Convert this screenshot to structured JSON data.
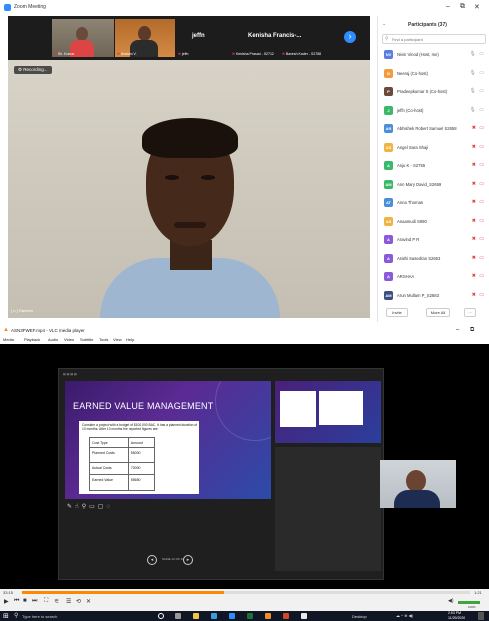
{
  "zoom": {
    "title": "Zoom Meeting",
    "window_controls": [
      "–",
      "⧉",
      "✕"
    ],
    "thumbnails": [
      {
        "label": "Sh. Kumar",
        "muted": true
      },
      {
        "label": "Ibrahim V.",
        "muted": true
      },
      {
        "label": "jeffn",
        "muted": true
      },
      {
        "label": "Kenisha Prasad - S2712",
        "muted": true
      },
      {
        "label": "Bavesh Kader - S2788",
        "muted": true
      }
    ],
    "speaker_name_a": "jeffn",
    "speaker_name_b": "Kenisha Francis-...",
    "next_arrow": "›",
    "view_badge": "Recording...",
    "self_label": "[ n ] Ganesh",
    "participants": {
      "title": "Participants (37)",
      "search_placeholder": "Find a participant",
      "list": [
        {
          "initials": "NV",
          "name": "Nivin Vinod (Host, me)",
          "color": "#5a7de0",
          "icons": "🎙 ▭",
          "red": false
        },
        {
          "initials": "N",
          "name": "Neeraj (Co-host)",
          "color": "#f39c3d",
          "icons": "🎙 ▭",
          "red": false
        },
        {
          "initials": "P",
          "name": "Pradeepkumar S (Co-host)",
          "color": "#6b4a3a",
          "icons": "🎙 ▭",
          "red": false
        },
        {
          "initials": "J",
          "name": "jeffn (Co-host)",
          "color": "#3bb86a",
          "icons": "🎙 ▭",
          "red": false
        },
        {
          "initials": "AR",
          "name": "Abhishek Robert Samuel S2658",
          "color": "#4a8fd8",
          "icons": "✖ ▭",
          "red": true
        },
        {
          "initials": "AS",
          "name": "Angel Sara Shaji",
          "color": "#f0b442",
          "icons": "✖ ▭",
          "red": true
        },
        {
          "initials": "A",
          "name": "Anju K - S2755",
          "color": "#3bb86a",
          "icons": "✖ ▭",
          "red": true
        },
        {
          "initials": "AM",
          "name": "Ann Mary David_S2659",
          "color": "#3bb86a",
          "icons": "✖ ▭",
          "red": true
        },
        {
          "initials": "AT",
          "name": "Anna Thomas",
          "color": "#4a8fd8",
          "icons": "✖ ▭",
          "red": true
        },
        {
          "initials": "AS",
          "name": "Anaamudi S990",
          "color": "#f0b442",
          "icons": "✖ ▭",
          "red": true
        },
        {
          "initials": "A",
          "name": "Aravind P R",
          "color": "#8a5ad8",
          "icons": "✖ ▭",
          "red": true
        },
        {
          "initials": "A",
          "name": "Arathi Sasedran S2663",
          "color": "#8a5ad8",
          "icons": "✖ ▭",
          "red": true
        },
        {
          "initials": "A",
          "name": "ARSHAA",
          "color": "#8a5ad8",
          "icons": "✖ ▭",
          "red": true
        },
        {
          "initials": "AM",
          "name": "Arun Mullam P_S2683",
          "color": "#3b4f82",
          "icons": "✖ ▭",
          "red": true
        }
      ],
      "invite_label": "Invite",
      "more_label": "More All",
      "dots_label": "..."
    }
  },
  "vlc": {
    "title": "ASN3FWEF.mp4 - VLC media player",
    "menu": [
      "Media",
      "Playback",
      "Audio",
      "Video",
      "Subtitle",
      "Tools",
      "View",
      "Help"
    ],
    "slide": {
      "title": "EARNED VALUE MANAGEMENT",
      "text": "Consider a project with a budget of $100,000 BAC. It has a planned duration of 10 months. After 10 months the reported figures are:",
      "table_headers": [
        "Cost Type",
        "Amount"
      ],
      "table_rows": [
        [
          "Planned Costs",
          "55000"
        ],
        [
          "Actual Costs",
          "70000"
        ],
        [
          "Earned Value",
          "55650"
        ]
      ],
      "footer": "SLIDE 12 OF 18"
    },
    "time_elapsed": "33:15",
    "time_total": "1:21",
    "progress": 0.45,
    "volume_label": "100%"
  },
  "taskbar": {
    "search_placeholder": "Type here to search",
    "desktop_label": "Desktop",
    "clock_time": "2:53 PM",
    "clock_date": "11/29/2020"
  }
}
